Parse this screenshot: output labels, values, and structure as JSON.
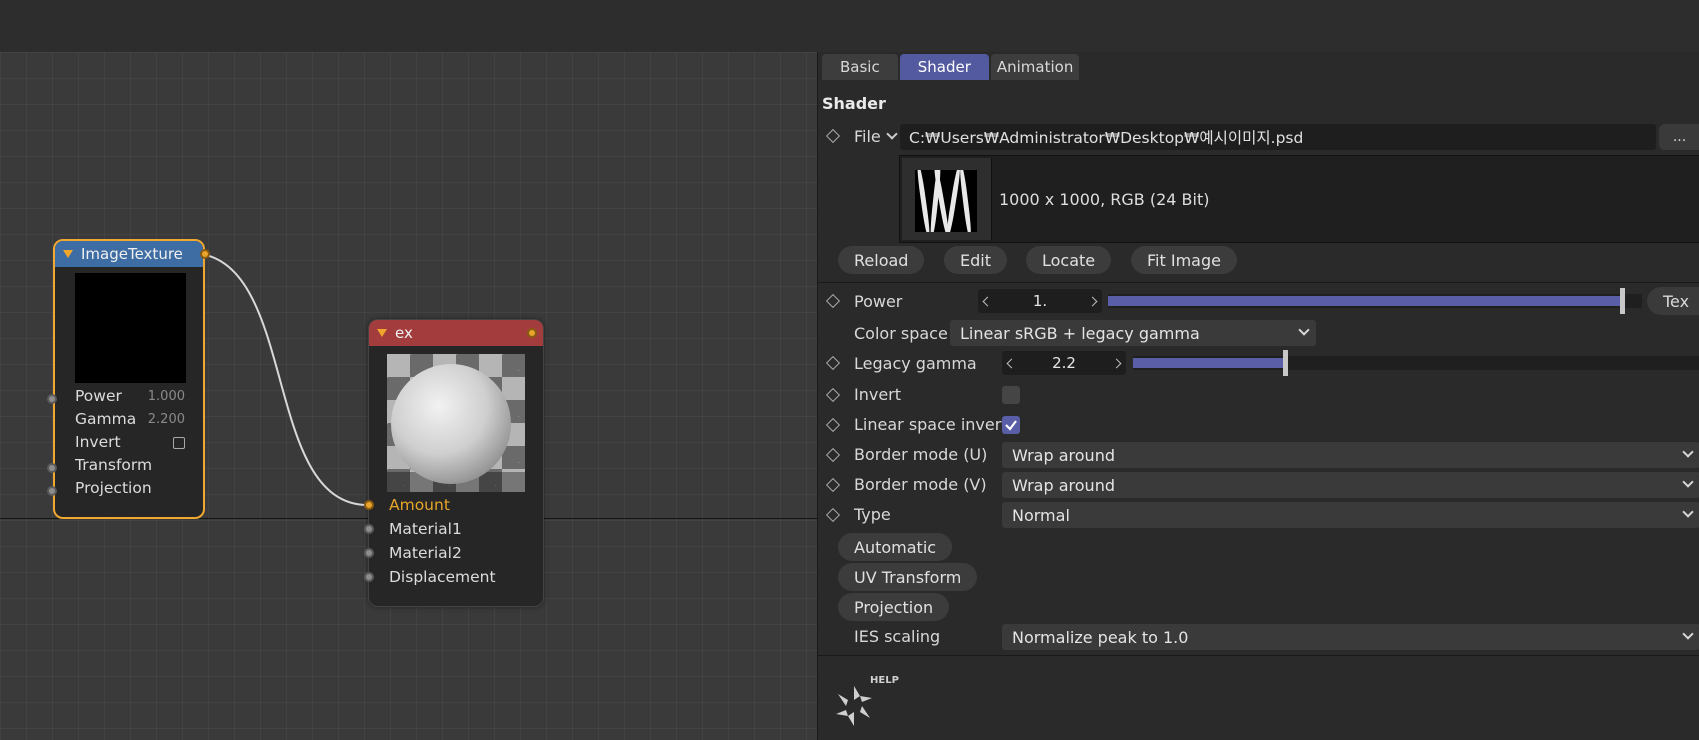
{
  "node_editor": {
    "image_texture_node": {
      "title": "ImageTexture",
      "rows": [
        {
          "label": "Power",
          "value": "1.000"
        },
        {
          "label": "Gamma",
          "value": "2.200"
        },
        {
          "label": "Invert"
        },
        {
          "label": "Transform"
        },
        {
          "label": "Projection"
        }
      ]
    },
    "ex_node": {
      "title": "ex",
      "rows": [
        "Amount",
        "Material1",
        "Material2",
        "Displacement"
      ]
    }
  },
  "panel": {
    "tabs": [
      "Basic",
      "Shader",
      "Animation"
    ],
    "active_tab": "Shader",
    "section_title": "Shader",
    "file": {
      "label": "File",
      "path": "C:₩Users₩Administrator₩Desktop₩예시이미지.psd",
      "browse_label": "..."
    },
    "image_info": "1000 x 1000, RGB (24 Bit)",
    "file_buttons": [
      "Reload",
      "Edit",
      "Locate",
      "Fit Image"
    ],
    "power": {
      "label": "Power",
      "value": "1.",
      "fill": 1.0,
      "tex_label": "Tex"
    },
    "color_space": {
      "label": "Color space",
      "value": "Linear sRGB + legacy gamma"
    },
    "legacy_gamma": {
      "label": "Legacy gamma",
      "value": "2.2",
      "fill": 0.27
    },
    "invert": {
      "label": "Invert",
      "checked": false
    },
    "linear_space_invert": {
      "label": "Linear space invert",
      "checked": true
    },
    "border_mode_u": {
      "label": "Border mode (U)",
      "value": "Wrap around"
    },
    "border_mode_v": {
      "label": "Border mode (V)",
      "value": "Wrap around"
    },
    "type": {
      "label": "Type",
      "value": "Normal"
    },
    "group_buttons": [
      "Automatic",
      "UV Transform",
      "Projection"
    ],
    "ies_scaling": {
      "label": "IES scaling",
      "value": "Normalize peak to 1.0"
    },
    "help_label": "HELP"
  },
  "colors": {
    "accent": "#545aa0",
    "node_selected": "#f0a830",
    "image_node_header": "#3e6da3",
    "ex_node_header": "#a33d3d"
  }
}
